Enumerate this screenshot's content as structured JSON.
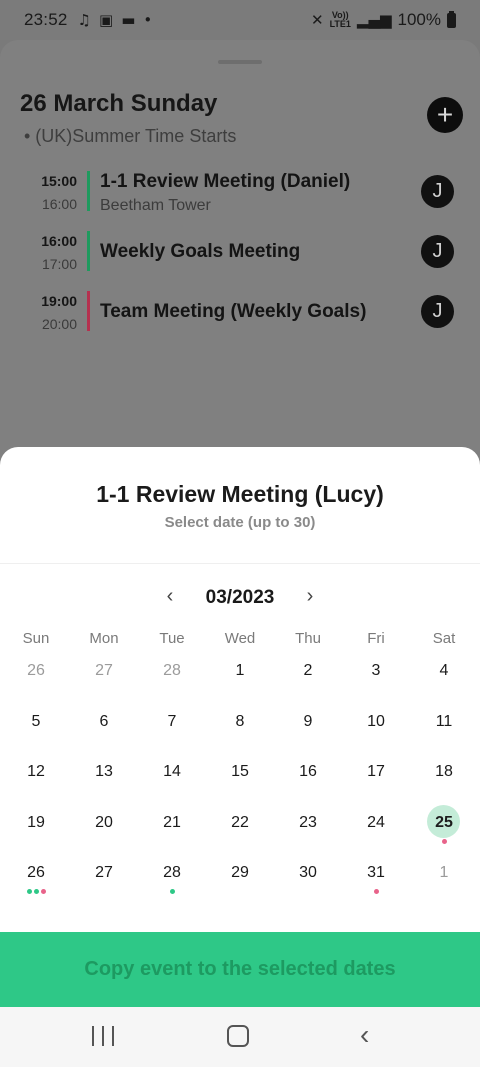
{
  "status_bar": {
    "time": "23:52",
    "battery": "100%",
    "lte_top": "Vo))",
    "lte_bottom": "LTE1"
  },
  "background": {
    "date_title": "26 March Sunday",
    "holiday": "• (UK)Summer Time Starts",
    "add_label": "+",
    "events": [
      {
        "start": "15:00",
        "end": "16:00",
        "title": "1-1 Review Meeting (Daniel)",
        "location": "Beetham Tower",
        "avatar": "J",
        "color": "#1e9a5e"
      },
      {
        "start": "16:00",
        "end": "17:00",
        "title": "Weekly Goals Meeting",
        "location": "",
        "avatar": "J",
        "color": "#1e9a5e"
      },
      {
        "start": "19:00",
        "end": "20:00",
        "title": "Team Meeting (Weekly Goals)",
        "location": "",
        "avatar": "J",
        "color": "#b5314f"
      }
    ]
  },
  "modal": {
    "title": "1-1 Review Meeting (Lucy)",
    "subtitle": "Select date (up to 30)",
    "month_label": "03/2023",
    "prev_glyph": "‹",
    "next_glyph": "›",
    "weekdays": [
      "Sun",
      "Mon",
      "Tue",
      "Wed",
      "Thu",
      "Fri",
      "Sat"
    ],
    "weeks": [
      [
        {
          "d": "26",
          "muted": true
        },
        {
          "d": "27",
          "muted": true
        },
        {
          "d": "28",
          "muted": true
        },
        {
          "d": "1"
        },
        {
          "d": "2"
        },
        {
          "d": "3"
        },
        {
          "d": "4"
        }
      ],
      [
        {
          "d": "5"
        },
        {
          "d": "6"
        },
        {
          "d": "7"
        },
        {
          "d": "8"
        },
        {
          "d": "9"
        },
        {
          "d": "10"
        },
        {
          "d": "11"
        }
      ],
      [
        {
          "d": "12"
        },
        {
          "d": "13"
        },
        {
          "d": "14"
        },
        {
          "d": "15"
        },
        {
          "d": "16"
        },
        {
          "d": "17"
        },
        {
          "d": "18"
        }
      ],
      [
        {
          "d": "19"
        },
        {
          "d": "20"
        },
        {
          "d": "21"
        },
        {
          "d": "22"
        },
        {
          "d": "23"
        },
        {
          "d": "24"
        },
        {
          "d": "25",
          "today": true,
          "dots": [
            "#e8638a"
          ]
        }
      ],
      [
        {
          "d": "26",
          "dots": [
            "#2ec887",
            "#2ec887",
            "#e8638a"
          ]
        },
        {
          "d": "27"
        },
        {
          "d": "28",
          "dots": [
            "#2ec887"
          ]
        },
        {
          "d": "29"
        },
        {
          "d": "30"
        },
        {
          "d": "31",
          "dots": [
            "#e8638a"
          ]
        },
        {
          "d": "1",
          "muted": true
        }
      ]
    ],
    "copy_button": "Copy event to the selected dates"
  },
  "colors": {
    "accent": "#2ec887",
    "today_bg": "#c4ecd8",
    "pink_dot": "#e8638a"
  }
}
